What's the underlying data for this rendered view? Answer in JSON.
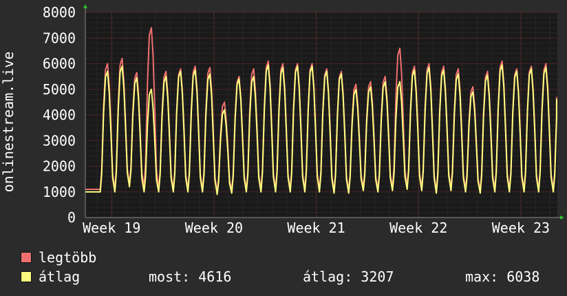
{
  "chart_data": {
    "type": "line",
    "ylabel": "onlinestream.live",
    "ylim": [
      0,
      8000
    ],
    "y_ticks": [
      "0",
      "1000",
      "2000",
      "3000",
      "4000",
      "5000",
      "6000",
      "7000",
      "8000"
    ],
    "x_ticks": [
      "Week 19",
      "Week 20",
      "Week 21",
      "Week 22",
      "Week 23"
    ],
    "x_tick_positions_days": [
      0,
      7,
      14,
      21,
      28
    ],
    "x_range_days": [
      -1.8,
      30.5
    ],
    "grid": true,
    "series": [
      {
        "name": "legtöbb",
        "color": "#f07070",
        "fill": false,
        "daily_peaks": [
          6000,
          6200,
          5650,
          7400,
          5700,
          5800,
          5900,
          5850,
          4500,
          5500,
          5800,
          6100,
          6000,
          6000,
          6000,
          5800,
          5700,
          5200,
          5300,
          5500,
          6600,
          5900,
          6000,
          5900,
          5800,
          5100,
          5700,
          6100,
          5800,
          5900,
          6000,
          5600
        ],
        "daily_troughs": [
          1100,
          1100,
          1300,
          1200,
          1100,
          1100,
          1100,
          1100,
          1000,
          1050,
          1100,
          1100,
          1100,
          1100,
          1100,
          1100,
          1050,
          1050,
          1150,
          1100,
          1150,
          1200,
          1150,
          1050,
          1150,
          1100,
          1050,
          1100,
          1100,
          1100,
          1100,
          1100
        ],
        "last": 4700
      },
      {
        "name": "átlag",
        "color": "#ffff80",
        "fill": false,
        "daily_peaks": [
          5700,
          5900,
          5450,
          5000,
          5500,
          5700,
          5750,
          5600,
          4200,
          5400,
          5500,
          5950,
          5850,
          5900,
          5900,
          5700,
          5600,
          5000,
          5100,
          5300,
          5300,
          5750,
          5850,
          5750,
          5600,
          4900,
          5550,
          5950,
          5700,
          5800,
          5850,
          5450
        ],
        "daily_troughs": [
          1000,
          1000,
          1200,
          1000,
          1000,
          1000,
          1000,
          1000,
          900,
          950,
          1000,
          1000,
          1000,
          1000,
          1000,
          1000,
          950,
          950,
          1050,
          1000,
          1050,
          1100,
          1050,
          950,
          1050,
          1000,
          950,
          1000,
          1000,
          1000,
          1000,
          1000
        ],
        "last": 4616
      }
    ]
  },
  "legend": {
    "max_label": "legtöbb",
    "avg_label": "átlag",
    "max_color": "#f07070",
    "avg_color": "#ffff80",
    "stats": {
      "now": "most: 4616",
      "avg": "átlag: 3207",
      "max": "max: 6038"
    }
  }
}
